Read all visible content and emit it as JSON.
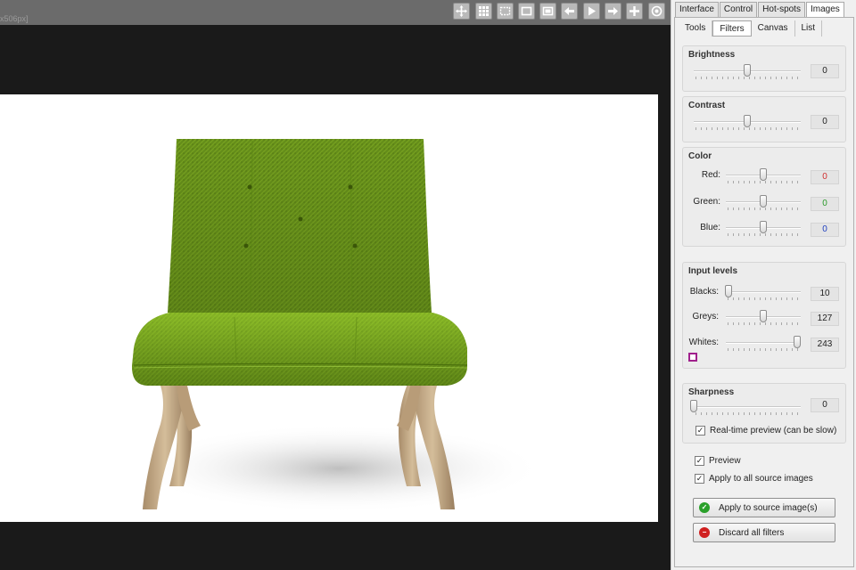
{
  "toolbar": {
    "size_label": "x506px]",
    "buttons": [
      {
        "icon": "move-icon"
      },
      {
        "icon": "grid-icon"
      },
      {
        "icon": "selection-icon"
      },
      {
        "icon": "frame-icon"
      },
      {
        "icon": "fit-icon"
      },
      {
        "icon": "arrow-left-icon"
      },
      {
        "icon": "play-icon"
      },
      {
        "icon": "arrow-right-icon"
      },
      {
        "icon": "plus-icon"
      },
      {
        "icon": "target-icon"
      }
    ]
  },
  "canvas": {
    "image": "green-fabric-lounge-chair"
  },
  "panel": {
    "main_tabs": [
      "Interface",
      "Control",
      "Hot-spots",
      "Images"
    ],
    "active_main_tab": "Images",
    "sub_tabs": [
      "Tools",
      "Filters",
      "Canvas",
      "List"
    ],
    "active_sub_tab": "Filters",
    "brightness": {
      "title": "Brightness",
      "value": "0",
      "level": 0.5
    },
    "contrast": {
      "title": "Contrast",
      "value": "0",
      "level": 0.5
    },
    "color": {
      "title": "Color",
      "red": {
        "label": "Red:",
        "value": "0",
        "level": 0.5,
        "color": "#d03030"
      },
      "green": {
        "label": "Green:",
        "value": "0",
        "level": 0.5,
        "color": "#2a9a2a"
      },
      "blue": {
        "label": "Blue:",
        "value": "0",
        "level": 0.5,
        "color": "#2040c0"
      }
    },
    "input_levels": {
      "title": "Input levels",
      "blacks": {
        "label": "Blacks:",
        "value": "10",
        "level": 0.04
      },
      "greys": {
        "label": "Greys:",
        "value": "127",
        "level": 0.5
      },
      "whites": {
        "label": "Whites:",
        "value": "243",
        "level": 0.95
      },
      "swatch_color": "#a0208c"
    },
    "sharpness": {
      "title": "Sharpness",
      "value": "0",
      "level": 0.0,
      "realtime_label": "Real-time preview (can be slow)",
      "realtime_checked": true
    },
    "preview": {
      "label": "Preview",
      "checked": true
    },
    "apply_all": {
      "label": "Apply to all source images",
      "checked": true
    },
    "apply_button": "Apply to source image(s)",
    "discard_button": "Discard all filters",
    "apply_color": "#2aa02a",
    "discard_color": "#d02020"
  }
}
